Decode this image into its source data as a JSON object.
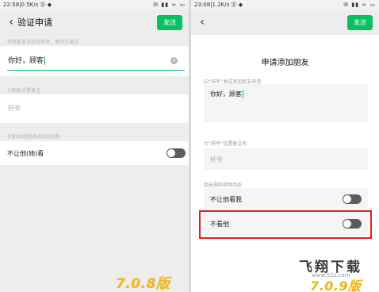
{
  "left": {
    "status": {
      "time_info": "22:58|0.5K/s ⓪ ◆",
      "icons": "✉ ▮▮ ≈ ▭"
    },
    "title": "验证申请",
    "send_label": "发送",
    "hint_message": "你需要发送验证申请，等对方通过",
    "message_value": "你好，顾客",
    "hint_remark": "为朋友设置备注",
    "remark_value": "轩爷",
    "hint_moments": "设置朋友圈和视频动态权限",
    "option_label": "不让他(她)看",
    "version": "7.0.8版"
  },
  "right": {
    "status": {
      "time_info": "23:08|1.2K/s ⓪ ◆",
      "icons": "✉ ▮▮ ≈ ▭"
    },
    "send_label": "发送",
    "heading": "申请添加朋友",
    "hint_message": "向“轩爷”发送添加朋友申请",
    "message_value": "你好，顾客",
    "hint_remark": "为“轩爷”设置备注名",
    "remark_value": "轩爷",
    "hint_moments": "朋友圈和视频动态",
    "option1_label": "不让他看我",
    "option2_label": "不看他",
    "version": "7.0.9版"
  },
  "brand": {
    "name": "飞翔下载",
    "url": "www.52z.com"
  },
  "colors": {
    "accent": "#07c160",
    "highlight": "#e0221a",
    "watermark": "#f5b80a"
  }
}
